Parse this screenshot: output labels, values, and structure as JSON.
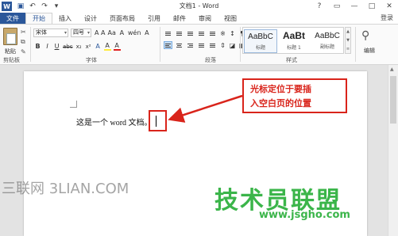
{
  "app": {
    "title": "文档1 - Word",
    "logo_letter": "W",
    "sign_in": "登录"
  },
  "quick_access": {
    "icons": [
      "save-icon",
      "undo-icon",
      "redo-icon",
      "customize-icon"
    ],
    "glyphs": [
      "💾",
      "↶",
      "↷",
      "▾"
    ]
  },
  "window_controls": [
    "?",
    "▭",
    "—",
    "□",
    "✕"
  ],
  "tabs": {
    "file": "文件",
    "items": [
      "开始",
      "插入",
      "设计",
      "页面布局",
      "引用",
      "邮件",
      "审阅",
      "视图"
    ],
    "active": "开始"
  },
  "ribbon": {
    "clipboard": {
      "paste_label": "粘贴",
      "group_label": "剪贴板"
    },
    "font": {
      "font_name": "宋体",
      "font_size": "四号",
      "grow_shrink": "A A",
      "case": "Aa",
      "clear": "A",
      "phonetic": "wén",
      "enclose": "A",
      "bold": "B",
      "italic": "I",
      "underline": "U",
      "strike": "abc",
      "sub": "x₂",
      "sup": "x²",
      "highlight": "A",
      "color": "A",
      "group_label": "字体"
    },
    "paragraph": {
      "group_label": "段落"
    },
    "styles": {
      "items": [
        {
          "preview": "AaBbC",
          "name": "标题"
        },
        {
          "preview": "AaBt",
          "name": "标题 1"
        },
        {
          "preview": "AaBbC",
          "name": "副标题"
        }
      ],
      "group_label": "样式"
    },
    "editing": {
      "label": "编辑"
    }
  },
  "document": {
    "text": "这是一个 word 文档。",
    "callout_line1": "光标定位于要插",
    "callout_line2": "入空白页的位置"
  },
  "watermarks": {
    "left": "三联网 3LIAN.COM",
    "right_big": "技术员联盟",
    "right_small": "www.jsgho.com"
  },
  "colors": {
    "accent": "#2b579a",
    "annotation_red": "#d9241b",
    "watermark_green": "#3bb54a"
  }
}
